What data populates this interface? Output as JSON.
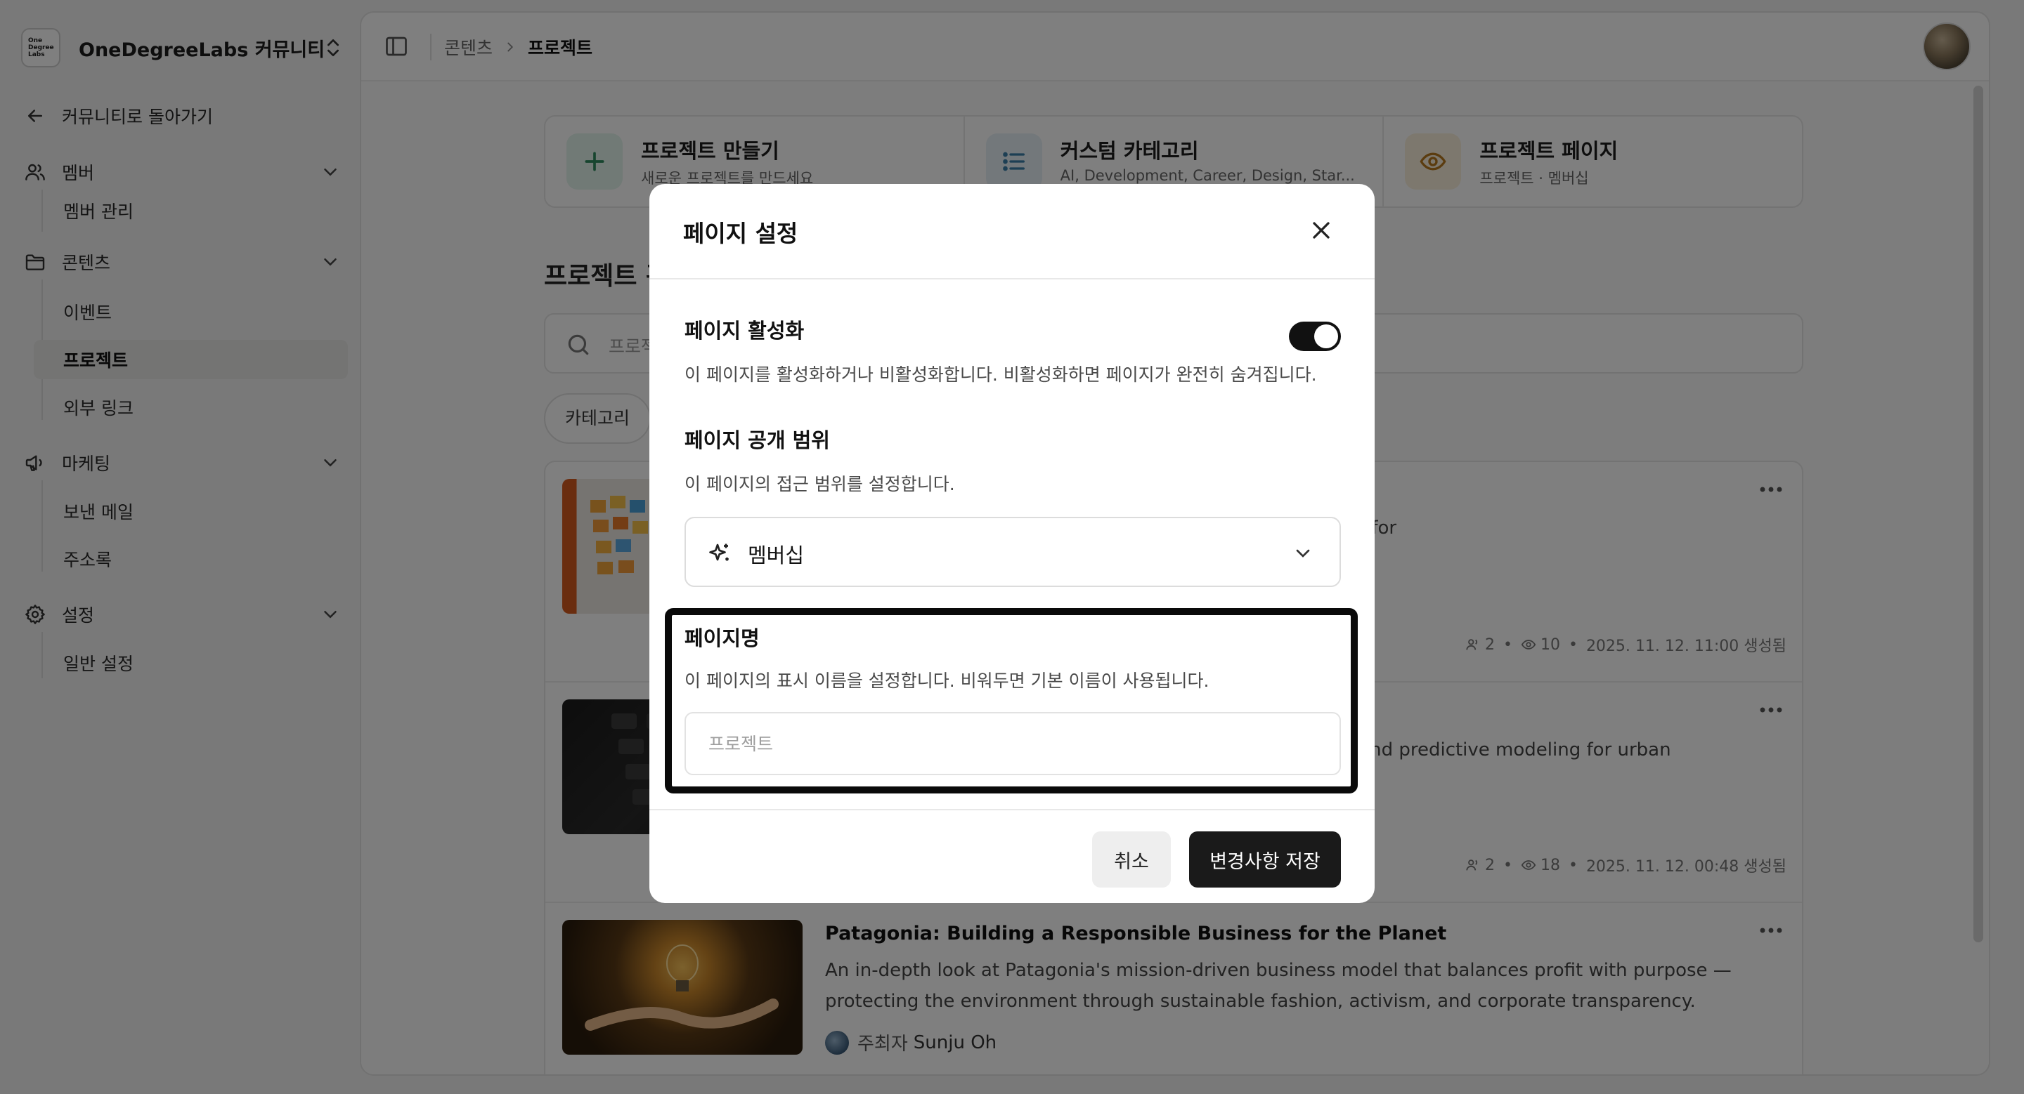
{
  "workspace": {
    "name": "OneDegreeLabs 커뮤니티",
    "logo_text": [
      "One",
      "Degree",
      "Labs"
    ]
  },
  "sidebar": {
    "back_label": "커뮤니티로 돌아가기",
    "sections": [
      {
        "label": "멤버",
        "icon": "users-icon",
        "items": [
          "멤버 관리"
        ]
      },
      {
        "label": "콘텐츠",
        "icon": "folder-icon",
        "items": [
          "이벤트",
          "프로젝트",
          "외부 링크"
        ],
        "active_item": "프로젝트"
      },
      {
        "label": "마케팅",
        "icon": "megaphone-icon",
        "items": [
          "보낸 메일",
          "주소록"
        ]
      },
      {
        "label": "설정",
        "icon": "gear-icon",
        "items": [
          "일반 설정"
        ]
      }
    ]
  },
  "breadcrumb": {
    "parent": "콘텐츠",
    "current": "프로젝트"
  },
  "quick_cards": [
    {
      "title": "프로젝트 만들기",
      "subtitle": "새로운 프로젝트를 만드세요",
      "icon": "plus-icon",
      "color": "#e3f4ec",
      "icon_color": "#2f8a5f"
    },
    {
      "title": "커스텀 카테고리",
      "subtitle": "AI, Development, Career, Design, Star...",
      "icon": "list-icon",
      "color": "#e6f1f7",
      "icon_color": "#3b7fa8"
    },
    {
      "title": "프로젝트 페이지",
      "subtitle": "프로젝트 · 멤버십",
      "icon": "eye-icon",
      "color": "#fbf1dc",
      "icon_color": "#b7791f"
    }
  ],
  "main": {
    "section_title": "프로젝트 관리",
    "search_placeholder": "프로젝트 검색",
    "filter_label": "카테고리"
  },
  "projects": [
    {
      "title": "",
      "description": "Connecting professionals and students to form agile teams for",
      "members": "2",
      "views": "10",
      "created": "2025. 11. 12. 11:00 생성됨"
    },
    {
      "title": "",
      "description": "Improving public welfare using satellite data, IoT sensors, and predictive modeling for urban planning and citizen health.",
      "members": "2",
      "views": "18",
      "created": "2025. 11. 12. 00:48 생성됨"
    },
    {
      "title": "Patagonia: Building a Responsible Business for the Planet",
      "description": "An in-depth look at Patagonia's mission-driven business model that balances profit with purpose — protecting the environment through sustainable fashion, activism, and corporate transparency.",
      "owner_label": "주최자",
      "owner_name": "Sunju Oh"
    }
  ],
  "modal": {
    "title": "페이지 설정",
    "activation": {
      "title": "페이지 활성화",
      "description": "이 페이지를 활성화하거나 비활성화합니다. 비활성화하면 페이지가 완전히 숨겨집니다.",
      "enabled": true
    },
    "visibility": {
      "title": "페이지 공개 범위",
      "description": "이 페이지의 접근 범위를 설정합니다.",
      "selected": "멤버십"
    },
    "page_name": {
      "title": "페이지명",
      "description": "이 페이지의 표시 이름을 설정합니다. 비워두면 기본 이름이 사용됩니다.",
      "placeholder": "프로젝트",
      "value": ""
    },
    "cancel_label": "취소",
    "save_label": "변경사항 저장"
  },
  "colors": {
    "overlay": "rgba(0,0,0,0.5)",
    "primary_button": "#1a1a1a",
    "active_nav": "#e8e8e6"
  }
}
